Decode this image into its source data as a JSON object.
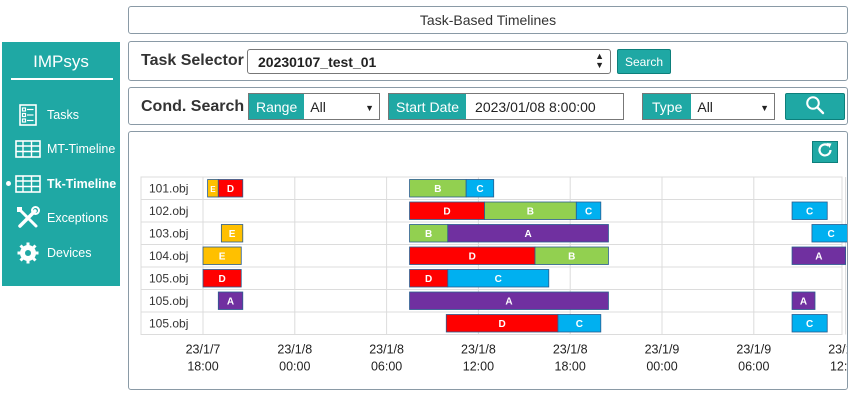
{
  "title": "Task-Based Timelines",
  "sidebar": {
    "brand": "IMPsys",
    "items": [
      {
        "label": "Tasks",
        "icon": "checklist-icon"
      },
      {
        "label": "MT-Timeline",
        "icon": "grid-icon"
      },
      {
        "label": "Tk-Timeline",
        "icon": "grid-icon",
        "active": true
      },
      {
        "label": "Exceptions",
        "icon": "tools-icon"
      },
      {
        "label": "Devices",
        "icon": "gear-icon"
      }
    ]
  },
  "task_selector": {
    "label": "Task Selector",
    "value": "20230107_test_01",
    "search_label": "Search"
  },
  "cond_search": {
    "label": "Cond. Search",
    "range_label": "Range",
    "range_value": "All",
    "start_date_label": "Start Date",
    "start_date_value": "2023/01/08 8:00:00",
    "type_label": "Type",
    "type_value": "All",
    "search_icon": "magnifier-icon"
  },
  "timeline": {
    "refresh_icon": "refresh-icon",
    "colors": {
      "A": "#7030a0",
      "B": "#92d050",
      "C": "#00b0f0",
      "D": "#ff0000",
      "E": "#ffc000"
    },
    "axis_start_hours": 0,
    "axis_ticks": [
      {
        "line1": "23/1/7",
        "line2": "18:00",
        "hour": 0
      },
      {
        "line1": "23/1/8",
        "line2": "00:00",
        "hour": 6
      },
      {
        "line1": "23/1/8",
        "line2": "06:00",
        "hour": 12
      },
      {
        "line1": "23/1/8",
        "line2": "12:00",
        "hour": 18
      },
      {
        "line1": "23/1/8",
        "line2": "18:00",
        "hour": 24
      },
      {
        "line1": "23/1/9",
        "line2": "00:00",
        "hour": 30
      },
      {
        "line1": "23/1/9",
        "line2": "06:00",
        "hour": 36
      },
      {
        "line1": "23/1/9",
        "line2": "12:00",
        "hour": 42
      }
    ],
    "rows": [
      {
        "name": "101.obj",
        "bars": [
          {
            "t": "E",
            "s": 0.3,
            "e": 1.0
          },
          {
            "t": "D",
            "s": 1.0,
            "e": 2.6
          },
          {
            "t": "B",
            "s": 13.5,
            "e": 17.2
          },
          {
            "t": "C",
            "s": 17.2,
            "e": 19.0
          }
        ]
      },
      {
        "name": "102.obj",
        "bars": [
          {
            "t": "D",
            "s": 13.5,
            "e": 18.4
          },
          {
            "t": "B",
            "s": 18.4,
            "e": 24.4
          },
          {
            "t": "C",
            "s": 24.4,
            "e": 26.0
          },
          {
            "t": "C",
            "s": 38.5,
            "e": 40.8
          }
        ]
      },
      {
        "name": "103.obj",
        "bars": [
          {
            "t": "E",
            "s": 1.2,
            "e": 2.6
          },
          {
            "t": "B",
            "s": 13.5,
            "e": 16.0
          },
          {
            "t": "A",
            "s": 16.0,
            "e": 26.5
          },
          {
            "t": "C",
            "s": 39.8,
            "e": 42.3
          }
        ]
      },
      {
        "name": "104.obj",
        "bars": [
          {
            "t": "E",
            "s": 0.0,
            "e": 2.5
          },
          {
            "t": "D",
            "s": 13.5,
            "e": 21.7
          },
          {
            "t": "B",
            "s": 21.7,
            "e": 26.5
          },
          {
            "t": "A",
            "s": 38.5,
            "e": 42.0
          }
        ]
      },
      {
        "name": "105.obj",
        "bars": [
          {
            "t": "D",
            "s": 0.0,
            "e": 2.5
          },
          {
            "t": "D",
            "s": 13.5,
            "e": 16.0
          },
          {
            "t": "C",
            "s": 16.0,
            "e": 22.6
          }
        ]
      },
      {
        "name": "105.obj",
        "bars": [
          {
            "t": "A",
            "s": 1.0,
            "e": 2.6
          },
          {
            "t": "A",
            "s": 13.5,
            "e": 26.5
          },
          {
            "t": "A",
            "s": 38.5,
            "e": 40.0
          }
        ]
      },
      {
        "name": "105.obj",
        "bars": [
          {
            "t": "D",
            "s": 15.9,
            "e": 23.2
          },
          {
            "t": "C",
            "s": 23.2,
            "e": 26.0
          },
          {
            "t": "C",
            "s": 38.5,
            "e": 40.8
          }
        ]
      }
    ]
  }
}
